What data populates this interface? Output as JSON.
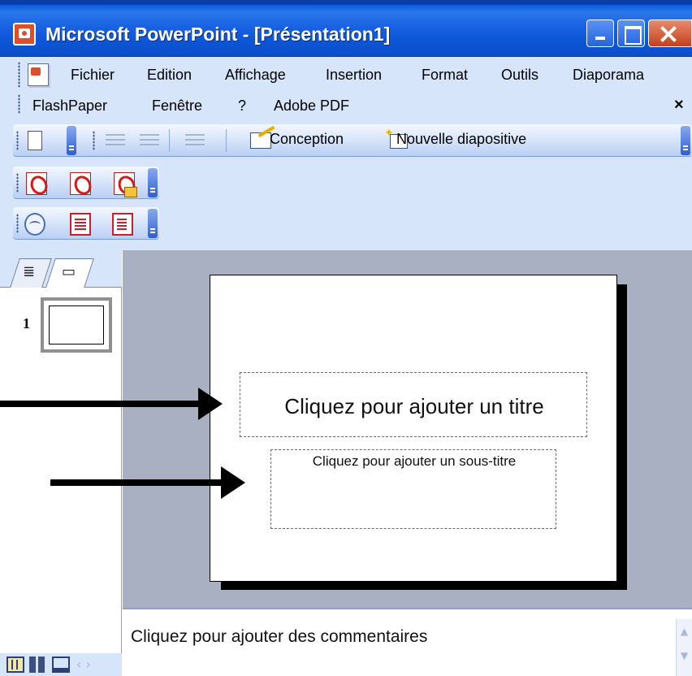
{
  "window": {
    "title": "Microsoft PowerPoint - [Présentation1]"
  },
  "menubar": {
    "items": [
      "Fichier",
      "Edition",
      "Affichage",
      "Insertion",
      "Format",
      "Outils",
      "Diaporama"
    ],
    "items_row2": [
      "FlashPaper",
      "Fenêtre",
      "?",
      "Adobe PDF"
    ],
    "close_glyph": "×"
  },
  "toolbar": {
    "design_label": "Conception",
    "new_slide_label": "Nouvelle diapositive"
  },
  "left_panel": {
    "tabs": [
      "outline-tab",
      "slides-tab"
    ],
    "slide_number": "1"
  },
  "slide": {
    "title_placeholder": "Cliquez pour ajouter un titre",
    "subtitle_placeholder": "Cliquez pour ajouter un sous-titre"
  },
  "notes": {
    "placeholder": "Cliquez pour ajouter des commentaires"
  },
  "icons": {
    "app": "powerpoint-icon",
    "window_controls": [
      "minimize-icon",
      "maximize-icon",
      "close-icon"
    ],
    "standard_toolbar": [
      "new-document-icon",
      "numbered-list-icon",
      "bullet-list-icon",
      "increase-indent-icon",
      "design-icon",
      "new-slide-icon"
    ],
    "pdf_toolbar": [
      "convert-to-pdf-icon",
      "convert-pdf-icon",
      "convert-and-email-pdf-icon"
    ],
    "flashpaper_toolbar": [
      "flashpaper-icon",
      "convert-to-flashpaper-icon",
      "convert-to-pdf-flashpaper-icon"
    ],
    "view_buttons": [
      "normal-view-icon",
      "slide-sorter-icon",
      "slide-show-icon"
    ]
  },
  "colors": {
    "titlebar": "#0b5bdc",
    "command_area": "#d7e5fa",
    "workspace": "#a9b0c2",
    "close_button": "#c4401d"
  }
}
